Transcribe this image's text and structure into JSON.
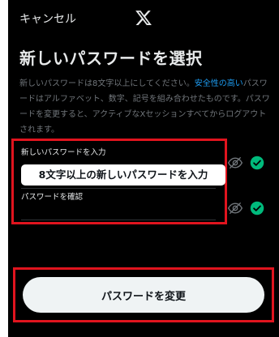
{
  "header": {
    "cancel_label": "キャンセル",
    "logo_icon": "x-logo-icon"
  },
  "title": "新しいパスワードを選択",
  "description": {
    "text_before": "新しいパスワードは8文字以上にしてください。",
    "link": "安全性の高い",
    "text_after": "パスワードはアルファベット、数字、記号を組み合わせたものです。パスワードを変更すると、アクティブなXセッションすべてからログアウトされます。"
  },
  "fields": {
    "new_password": {
      "label": "新しいパスワードを入力",
      "value": "",
      "eye_icon": "eye-off-icon",
      "status_icon": "check-circle-icon"
    },
    "confirm_password": {
      "label": "パスワードを確認",
      "value": "",
      "eye_icon": "eye-off-icon",
      "status_icon": "check-circle-icon"
    }
  },
  "annotation_text": "8文字以上の新しいパスワードを入力",
  "submit_label": "パスワードを変更",
  "colors": {
    "background": "#000000",
    "text": "#e7e9ea",
    "muted": "#71767b",
    "link": "#1d9bf0",
    "check": "#00ba7c",
    "highlight": "#e0141e",
    "button": "#eff3f4"
  }
}
